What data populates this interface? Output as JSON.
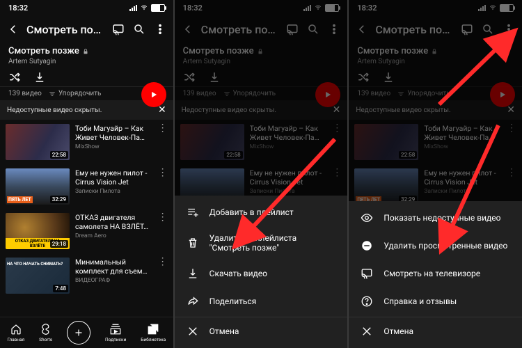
{
  "status": {
    "time": "18:32"
  },
  "header": {
    "title": "Смотреть позже"
  },
  "playlist": {
    "name": "Смотреть позже",
    "author": "Artem Sutyagin"
  },
  "sub": {
    "count": "139 видео",
    "sort": "Упорядочить"
  },
  "notice": {
    "text": "Недоступные видео скрыты."
  },
  "videos": [
    {
      "title": "Тоби Магуайр – Как Живет Человек-Па…",
      "channel": "MixShow",
      "duration": "22:58"
    },
    {
      "title": "Ему не нужен пилот - Cirrus Vision Jet",
      "channel": "Записки Пилота",
      "duration": "32:29",
      "badge": "ПЯТЬ ЛЕТ"
    },
    {
      "title": "ОТКАЗ двигателя самолета НА ВЗЛЁТ…",
      "channel": "Dream Aero",
      "duration": "29:18",
      "badge": "ОТКАЗ ДВИГАТЕЛЯ\nНА ВЗЛЁТЕ"
    },
    {
      "title": "Минимальный комплект для съем…",
      "channel": "ВИДЕОГРАФ",
      "duration": "7:48",
      "badge": "НА ЧТО\nНАЧАТЬ\nСНИМАТЬ?"
    }
  ],
  "tabs": {
    "home": "Главная",
    "shorts": "Shorts",
    "subs": "Подписки",
    "library": "Библиотека"
  },
  "sheetA": {
    "add": "Добавить в плейлист",
    "remove": "Удалить из плейлиста \"Смотреть позже\"",
    "download": "Скачать видео",
    "share": "Поделиться",
    "cancel": "Отмена"
  },
  "sheetB": {
    "show": "Показать недоступные видео",
    "removeWatched": "Удалить просмотренные видео",
    "tv": "Смотреть на телевизоре",
    "help": "Справка и отзывы",
    "cancel": "Отмена"
  }
}
